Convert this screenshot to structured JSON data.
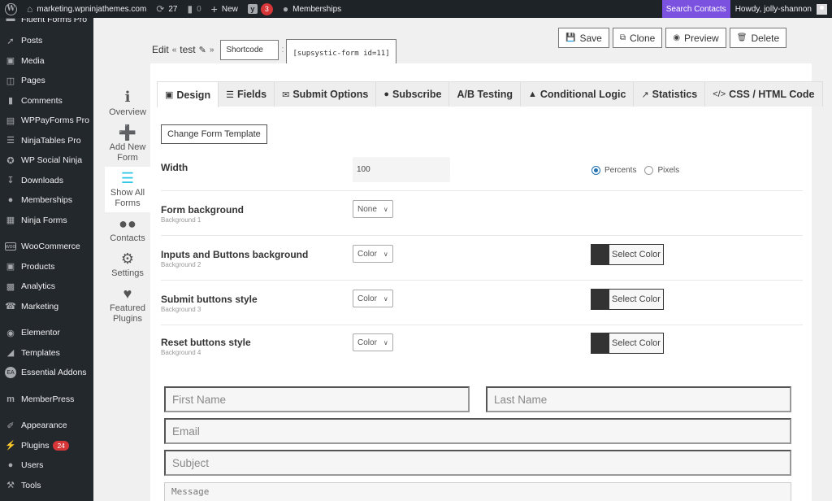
{
  "admin_bar": {
    "site_name": "marketing.wpninjathemes.com",
    "updates_count": "27",
    "comments_count": "0",
    "new_label": "New",
    "yoast_badge": "3",
    "memberships_label": "Memberships",
    "search_contacts_label": "Search Contacts",
    "howdy_label": "Howdy, jolly-shannon"
  },
  "admin_menu": {
    "items": [
      {
        "label": "Fluent Forms Pro",
        "icon": "fluent-forms-icon"
      },
      {
        "label": "Posts",
        "icon": "pin-icon"
      },
      {
        "label": "Media",
        "icon": "media-icon"
      },
      {
        "label": "Pages",
        "icon": "pages-icon"
      },
      {
        "label": "Comments",
        "icon": "comment-icon"
      },
      {
        "label": "WPPayForms Pro",
        "icon": "payform-icon"
      },
      {
        "label": "NinjaTables Pro",
        "icon": "table-icon"
      },
      {
        "label": "WP Social Ninja",
        "icon": "social-ninja-icon"
      },
      {
        "label": "Downloads",
        "icon": "download-icon"
      },
      {
        "label": "Memberships",
        "icon": "groups-icon"
      },
      {
        "label": "Ninja Forms",
        "icon": "forms-icon"
      },
      {
        "label": "WooCommerce",
        "icon": "woo-icon"
      },
      {
        "label": "Products",
        "icon": "archive-icon"
      },
      {
        "label": "Analytics",
        "icon": "bar-chart-icon"
      },
      {
        "label": "Marketing",
        "icon": "megaphone-icon"
      },
      {
        "label": "Elementor",
        "icon": "elementor-icon"
      },
      {
        "label": "Templates",
        "icon": "folder-icon"
      },
      {
        "label": "Essential Addons",
        "icon": "ea-icon"
      },
      {
        "label": "MemberPress",
        "icon": "memberpress-icon"
      },
      {
        "label": "Appearance",
        "icon": "brush-icon"
      },
      {
        "label": "Plugins",
        "icon": "plugin-icon",
        "badge": "24"
      },
      {
        "label": "Users",
        "icon": "user-icon"
      },
      {
        "label": "Tools",
        "icon": "wrench-icon"
      }
    ]
  },
  "edit_header": {
    "edit_label": "Edit",
    "form_name": "test",
    "shortcode_select": "Shortcode",
    "shortcode_value": "[supsystic-form id=11]"
  },
  "actions": {
    "save": "Save",
    "clone": "Clone",
    "preview": "Preview",
    "delete": "Delete"
  },
  "plugin_nav": [
    {
      "label": "Overview",
      "icon": "info-icon"
    },
    {
      "label": "Add New Form",
      "icon": "plus-circle-icon"
    },
    {
      "label": "Show All Forms",
      "icon": "list-icon",
      "active": true
    },
    {
      "label": "Contacts",
      "icon": "users-icon"
    },
    {
      "label": "Settings",
      "icon": "gear-icon"
    },
    {
      "label": "Featured Plugins",
      "icon": "heart-icon"
    }
  ],
  "tabs": [
    {
      "label": "Design",
      "active": true
    },
    {
      "label": "Fields"
    },
    {
      "label": "Submit Options"
    },
    {
      "label": "Subscribe"
    },
    {
      "label": "A/B Testing"
    },
    {
      "label": "Conditional Logic"
    },
    {
      "label": "Statistics"
    },
    {
      "label": "CSS / HTML Code"
    }
  ],
  "design": {
    "change_template_label": "Change Form Template",
    "width": {
      "label": "Width",
      "value": "100",
      "unit_options": [
        "Percents",
        "Pixels"
      ],
      "unit_selected": "Percents"
    },
    "rows": [
      {
        "label": "Form background",
        "sub": "Background 1",
        "select": "None"
      },
      {
        "label": "Inputs and Buttons background",
        "sub": "Background 2",
        "select": "Color",
        "color_button": "Select Color",
        "color": "#333333"
      },
      {
        "label": "Submit buttons style",
        "sub": "Background 3",
        "select": "Color",
        "color_button": "Select Color",
        "color": "#333333"
      },
      {
        "label": "Reset buttons style",
        "sub": "Background 4",
        "select": "Color",
        "color_button": "Select Color",
        "color": "#333333"
      }
    ]
  },
  "form_preview": {
    "first_name_placeholder": "First Name",
    "last_name_placeholder": "Last Name",
    "email_placeholder": "Email",
    "subject_placeholder": "Subject",
    "message_placeholder": "Message"
  },
  "colors": {
    "admin_bar_bg": "#1d2327",
    "admin_menu_bg": "#23282d",
    "search_contacts_bg": "#7b52e0",
    "badge_red": "#d63638",
    "active_nav_icon": "#2dc6e6",
    "radio_accent": "#2271b1"
  }
}
